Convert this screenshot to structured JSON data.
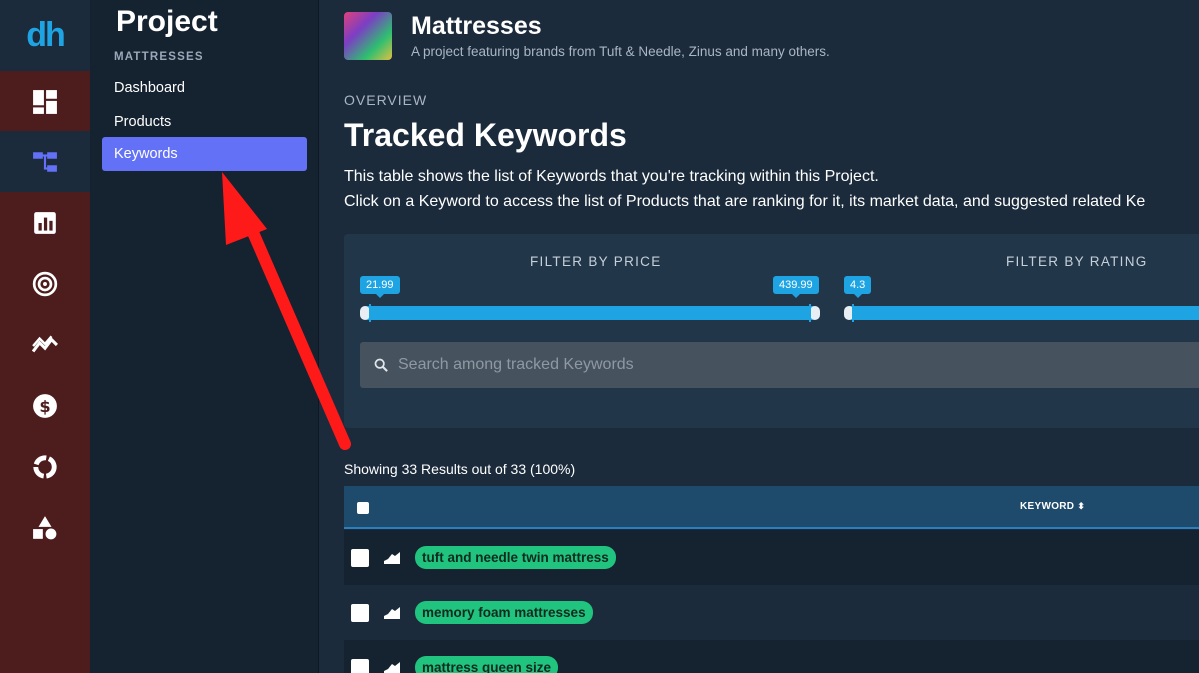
{
  "rail": {
    "logo": "dh",
    "items": [
      {
        "icon": "dashboard-grid-icon"
      },
      {
        "icon": "project-tree-icon",
        "active": true
      },
      {
        "icon": "bar-chart-icon"
      },
      {
        "icon": "target-icon"
      },
      {
        "icon": "trend-icon"
      },
      {
        "icon": "dollar-icon"
      },
      {
        "icon": "donut-icon"
      },
      {
        "icon": "shapes-icon"
      }
    ]
  },
  "sidebar": {
    "title": "Project",
    "subtitle": "MATTRESSES",
    "links": [
      {
        "label": "Dashboard"
      },
      {
        "label": "Products"
      },
      {
        "label": "Keywords",
        "active": true
      }
    ]
  },
  "project": {
    "name": "Mattresses",
    "description": "A project featuring brands from Tuft & Needle, Zinus and many others."
  },
  "page": {
    "section": "OVERVIEW",
    "title": "Tracked Keywords",
    "intro_line1": "This table shows the list of Keywords that you're tracking within this Project.",
    "intro_line2": "Click on a Keyword to access the list of Products that are ranking for it, its market data, and suggested related Ke"
  },
  "filters": {
    "price": {
      "label": "FILTER BY PRICE",
      "min": "21.99",
      "max": "439.99"
    },
    "rating": {
      "label": "FILTER BY RATING",
      "min": "4.3"
    },
    "search_placeholder": "Search among tracked Keywords"
  },
  "table": {
    "results_text": "Showing 33 Results out of 33 (100%)",
    "column_keyword": "KEYWORD",
    "rows": [
      {
        "keyword": "tuft and needle twin mattress"
      },
      {
        "keyword": "memory foam mattresses"
      },
      {
        "keyword": "mattress queen size"
      }
    ]
  },
  "colors": {
    "accent": "#6271f5",
    "slider": "#1fa4e3",
    "keyword_pill": "#20c47e",
    "annotation_arrow": "#ff1a1a"
  }
}
